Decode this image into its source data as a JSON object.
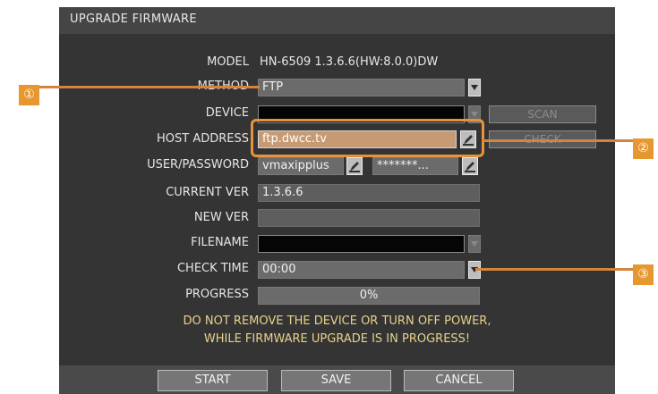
{
  "dialog": {
    "title": "UPGRADE FIRMWARE"
  },
  "fields": {
    "model": {
      "label": "MODEL",
      "value": "HN-6509 1.3.6.6(HW:8.0.0)DW"
    },
    "method": {
      "label": "METHOD",
      "value": "FTP"
    },
    "device": {
      "label": "DEVICE",
      "value": ""
    },
    "host_address": {
      "label": "HOST ADDRESS",
      "value": "ftp.dwcc.tv"
    },
    "user_password": {
      "label": "USER/PASSWORD",
      "user": "vmaxipplus",
      "password": "*******..."
    },
    "current_ver": {
      "label": "CURRENT VER",
      "value": "1.3.6.6"
    },
    "new_ver": {
      "label": "NEW VER",
      "value": ""
    },
    "filename": {
      "label": "FILENAME",
      "value": ""
    },
    "check_time": {
      "label": "CHECK TIME",
      "value": "00:00"
    },
    "progress": {
      "label": "PROGRESS",
      "value": "0%",
      "fraction": 0
    }
  },
  "side_buttons": {
    "scan": "SCAN",
    "check": "CHECK"
  },
  "warning": {
    "line1": "DO NOT REMOVE THE DEVICE OR TURN OFF POWER,",
    "line2": "WHILE FIRMWARE UPGRADE IS IN PROGRESS!"
  },
  "buttons": {
    "start": "START",
    "save": "SAVE",
    "cancel": "CANCEL"
  },
  "callouts": {
    "one": "①",
    "two": "②",
    "three": "③"
  },
  "colors": {
    "accent_orange": "#e6972f",
    "highlight_field": "#c79a73",
    "warning_text": "#e8d28a"
  }
}
